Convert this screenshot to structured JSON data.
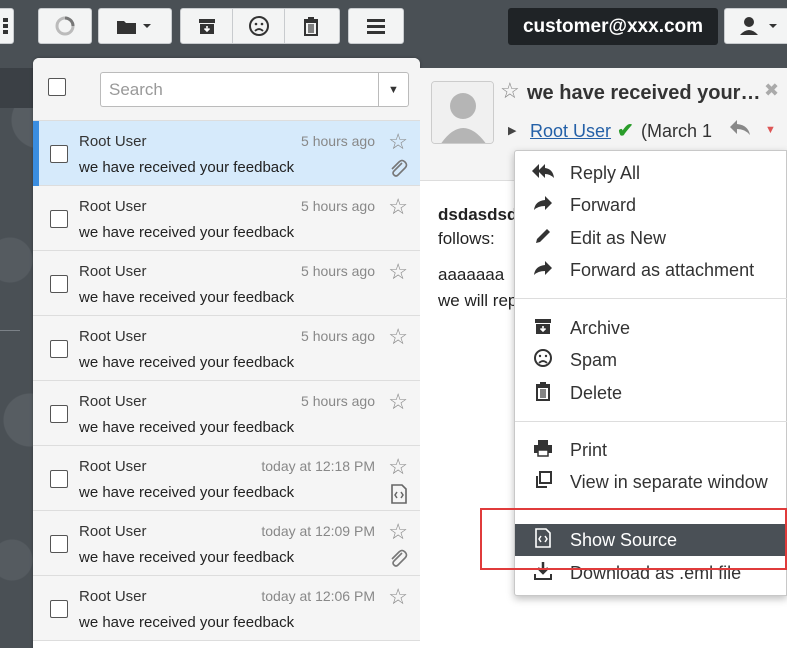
{
  "account": {
    "email": "customer@xxx.com"
  },
  "list": {
    "search_placeholder": "Search",
    "rows": [
      {
        "from": "Root User",
        "time": "5 hours ago",
        "subject": "we have received your feedback",
        "attachment": "paperclip"
      },
      {
        "from": "Root User",
        "time": "5 hours ago",
        "subject": "we have received your feedback",
        "attachment": ""
      },
      {
        "from": "Root User",
        "time": "5 hours ago",
        "subject": "we have received your feedback",
        "attachment": ""
      },
      {
        "from": "Root User",
        "time": "5 hours ago",
        "subject": "we have received your feedback",
        "attachment": ""
      },
      {
        "from": "Root User",
        "time": "5 hours ago",
        "subject": "we have received your feedback",
        "attachment": ""
      },
      {
        "from": "Root User",
        "time": "today at 12:18 PM",
        "subject": "we have received your feedback",
        "attachment": "code-file"
      },
      {
        "from": "Root User",
        "time": "today at 12:09 PM",
        "subject": "we have received your feedback",
        "attachment": "paperclip"
      },
      {
        "from": "Root User",
        "time": "today at 12:06 PM",
        "subject": "we have received your feedback",
        "attachment": ""
      }
    ]
  },
  "preview": {
    "subject": "we have received your…",
    "from": "Root User",
    "date": "(March 1",
    "body_bold": "dsdasdsd",
    "body_line2": "follows:",
    "body_line3": "aaaaaaa",
    "body_line4": "we will rep"
  },
  "menu": {
    "reply_all": "Reply All",
    "forward": "Forward",
    "edit_as_new": "Edit as New",
    "forward_attachment": "Forward as attachment",
    "archive": "Archive",
    "spam": "Spam",
    "delete": "Delete",
    "print": "Print",
    "view_separate": "View in separate window",
    "show_source": "Show Source",
    "download_eml": "Download as .eml file"
  },
  "colors": {
    "accent": "#3a8de0",
    "highlight_box": "#e03b3b",
    "active_menu": "#4a5056"
  }
}
